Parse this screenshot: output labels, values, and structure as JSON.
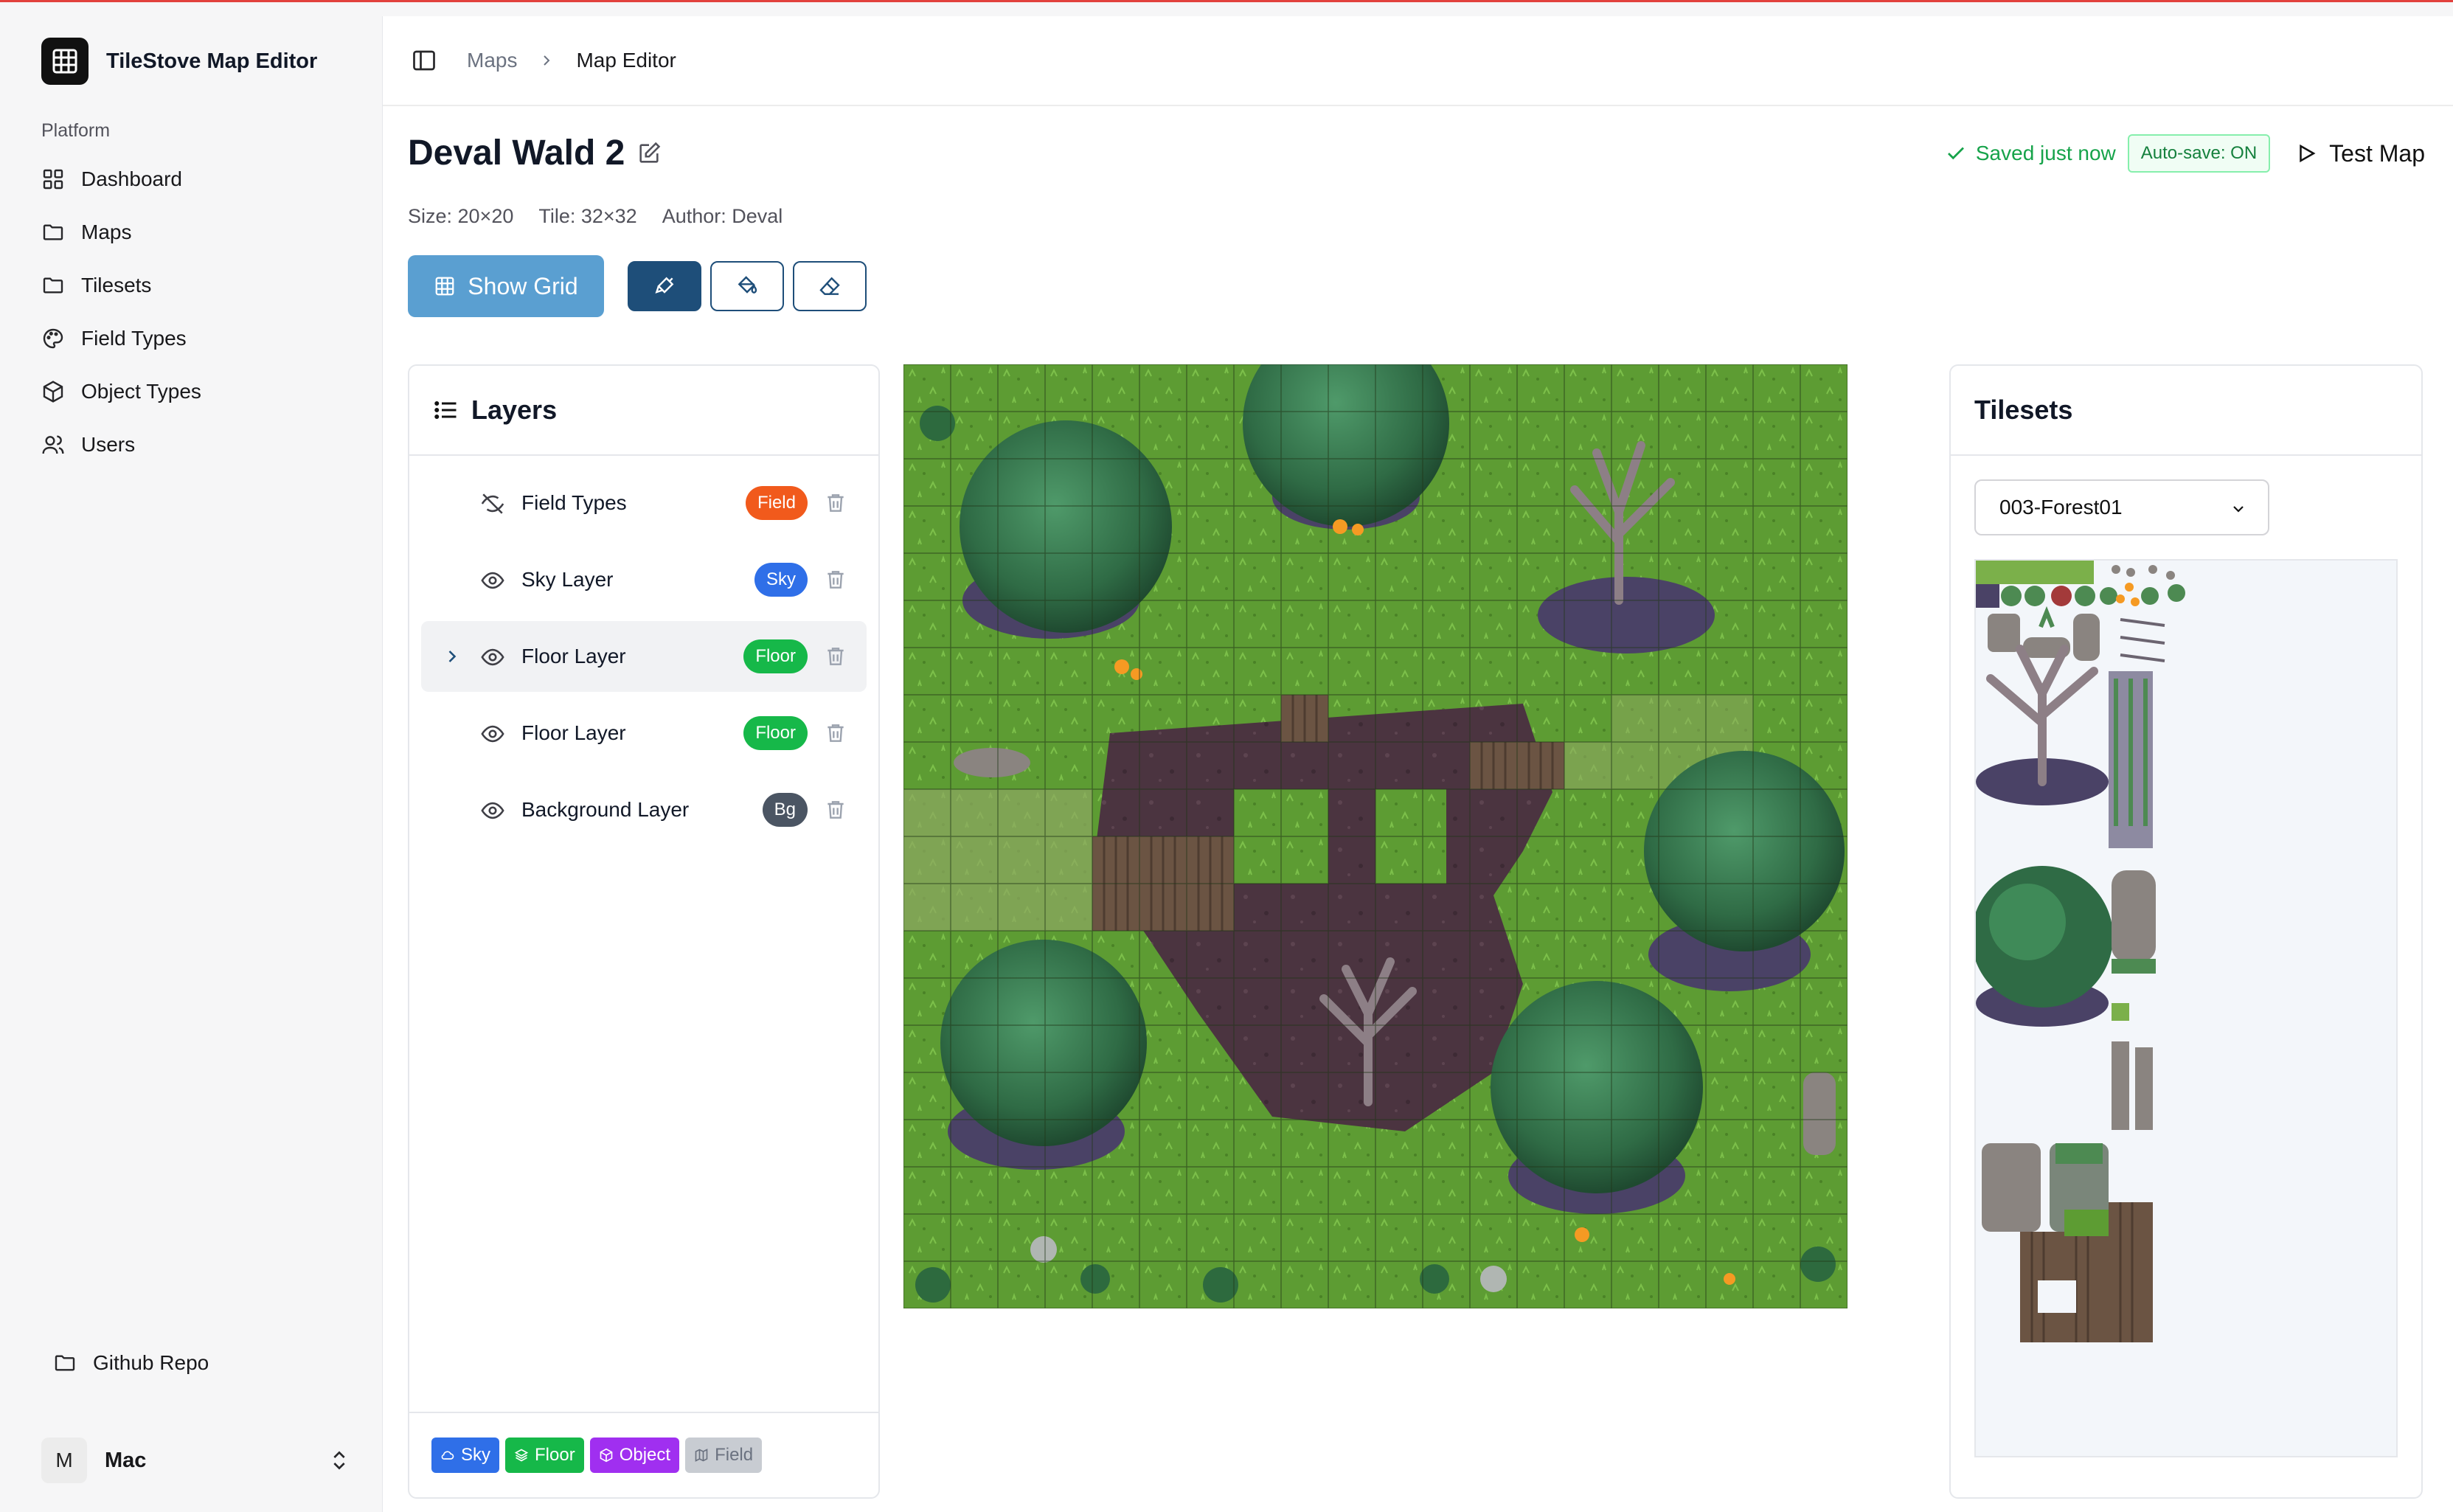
{
  "app": {
    "title": "TileStove Map Editor"
  },
  "sidebar": {
    "section_label": "Platform",
    "items": [
      {
        "label": "Dashboard",
        "icon": "dashboard-icon"
      },
      {
        "label": "Maps",
        "icon": "folder-icon"
      },
      {
        "label": "Tilesets",
        "icon": "folder-icon"
      },
      {
        "label": "Field Types",
        "icon": "palette-icon"
      },
      {
        "label": "Object Types",
        "icon": "cube-icon"
      },
      {
        "label": "Users",
        "icon": "users-icon"
      }
    ],
    "github_label": "Github Repo",
    "user": {
      "initial": "M",
      "name": "Mac"
    }
  },
  "breadcrumb": {
    "parent": "Maps",
    "current": "Map Editor"
  },
  "map": {
    "title": "Deval Wald 2",
    "size": "Size: 20×20",
    "tile": "Tile: 32×32",
    "author": "Author: Deval"
  },
  "status": {
    "saved": "Saved just now",
    "autosave": "Auto-save: ON",
    "test_map": "Test Map"
  },
  "toolbar": {
    "show_grid": "Show Grid"
  },
  "layers": {
    "title": "Layers",
    "items": [
      {
        "name": "Field Types",
        "badge": "Field",
        "badge_color": "#f15a1c",
        "visible": false,
        "expandable": false,
        "selected": false
      },
      {
        "name": "Sky Layer",
        "badge": "Sky",
        "badge_color": "#2f6fe8",
        "visible": true,
        "expandable": false,
        "selected": false
      },
      {
        "name": "Floor Layer",
        "badge": "Floor",
        "badge_color": "#16b849",
        "visible": true,
        "expandable": true,
        "selected": true
      },
      {
        "name": "Floor Layer",
        "badge": "Floor",
        "badge_color": "#16b849",
        "visible": true,
        "expandable": false,
        "selected": false
      },
      {
        "name": "Background Layer",
        "badge": "Bg",
        "badge_color": "#4b5563",
        "visible": true,
        "expandable": false,
        "selected": false
      }
    ],
    "legend": [
      {
        "label": "Sky",
        "color": "#2f6fe8"
      },
      {
        "label": "Floor",
        "color": "#16b849"
      },
      {
        "label": "Object",
        "color": "#a02ff0"
      },
      {
        "label": "Field",
        "color": "#c8ccd2"
      }
    ]
  },
  "tilesets": {
    "title": "Tilesets",
    "selected": "003-Forest01"
  },
  "colors": {
    "accent": "#1e4e79",
    "grid_button": "#5a9fd1",
    "grass": "#5b9a32",
    "saved": "#16a34a"
  }
}
